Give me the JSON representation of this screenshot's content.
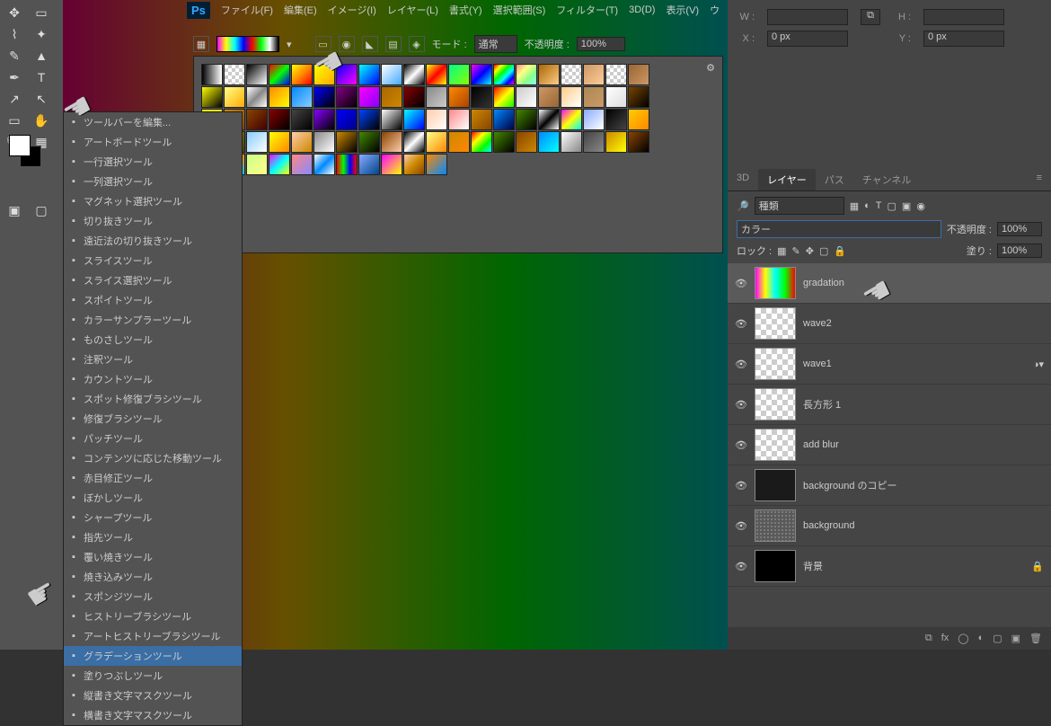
{
  "menu": {
    "items": [
      "ファイル(F)",
      "編集(E)",
      "イメージ(I)",
      "レイヤー(L)",
      "書式(Y)",
      "選択範囲(S)",
      "フィルター(T)",
      "3D(D)",
      "表示(V)",
      "ウ"
    ],
    "ps": "Ps"
  },
  "option_bar": {
    "mode_label": "モード :",
    "mode_value": "通常",
    "opacity_label": "不透明度 :",
    "opacity_value": "100%"
  },
  "props": {
    "w": "W :",
    "h": "H :",
    "x": "X :",
    "y": "Y :",
    "x_val": "0 px",
    "y_val": "0 px"
  },
  "tabs": {
    "items": [
      "3D",
      "レイヤー",
      "パス",
      "チャンネル"
    ],
    "active": 1
  },
  "layer_opts": {
    "kind": "種類",
    "blend": "カラー",
    "opacity_label": "不透明度 :",
    "opacity_value": "100%",
    "lock_label": "ロック :",
    "fill_label": "塗り :",
    "fill_value": "100%"
  },
  "layers": [
    {
      "name": "gradation",
      "thumb": "grad",
      "sel": true
    },
    {
      "name": "wave2",
      "thumb": "checker"
    },
    {
      "name": "wave1",
      "thumb": "checker",
      "fx": true
    },
    {
      "name": "長方形 1",
      "thumb": "checker"
    },
    {
      "name": "add blur",
      "thumb": "checker"
    },
    {
      "name": "background のコピー",
      "thumb": "dark"
    },
    {
      "name": "background",
      "thumb": "noise"
    },
    {
      "name": "背景",
      "thumb": "black",
      "lock": true
    }
  ],
  "tool_menu": {
    "items": [
      "ツールバーを編集...",
      "アートボードツール",
      "一行選択ツール",
      "一列選択ツール",
      "マグネット選択ツール",
      "切り抜きツール",
      "遠近法の切り抜きツール",
      "スライスツール",
      "スライス選択ツール",
      "スポイトツール",
      "カラーサンプラーツール",
      "ものさしツール",
      "注釈ツール",
      "カウントツール",
      "スポット修復ブラシツール",
      "修復ブラシツール",
      "パッチツール",
      "コンテンツに応じた移動ツール",
      "赤目修正ツール",
      "ぼかしツール",
      "シャープツール",
      "指先ツール",
      "覆い焼きツール",
      "焼き込みツール",
      "スポンジツール",
      "ヒストリーブラシツール",
      "アートヒストリーブラシツール",
      "グラデーションツール",
      "塗りつぶしツール",
      "縦書き文字マスクツール",
      "横書き文字マスクツール"
    ],
    "selected": 27
  },
  "gradient_swatches": [
    "linear-gradient(90deg,#000,#fff)",
    "repeating-conic-gradient(#ccc 0 25%,#fff 0 50%) 0 0/8px 8px",
    "linear-gradient(135deg,#000,#fff)",
    "linear-gradient(135deg,#f00,#0f0,#00f)",
    "linear-gradient(135deg,#ff0,#f80,#f00)",
    "linear-gradient(135deg,#ff0,#fa0)",
    "linear-gradient(135deg,#00f,#80f,#f0f)",
    "linear-gradient(135deg,#0ff,#00f)",
    "linear-gradient(135deg,#fff,#4af)",
    "linear-gradient(135deg,#000,#fff,#000)",
    "linear-gradient(135deg,#ff0,#f00,#ff0)",
    "linear-gradient(135deg,#0f8,#8f0)",
    "linear-gradient(135deg,#f0f,#00f,#0ff)",
    "linear-gradient(135deg,#f00,#ff0,#0f0,#0ff,#00f,#f0f)",
    "linear-gradient(135deg,#f88,#ff8,#8f8,#8ff)",
    "linear-gradient(135deg,#a60,#fc8)",
    "repeating-conic-gradient(#ccc 0 25%,#fff 0 50%) 0 0/8px 8px",
    "linear-gradient(135deg,#c96,#fc9)",
    "repeating-conic-gradient(#ccc 0 25%,#fff 0 50%) 0 0/8px 8px",
    "linear-gradient(135deg,#963,#c96)",
    "linear-gradient(135deg,#ff0,#000)",
    "linear-gradient(135deg,#ff8,#fa0)",
    "linear-gradient(135deg,#fff,#888,#fff)",
    "linear-gradient(135deg,#f80,#ff0)",
    "linear-gradient(135deg,#08f,#8cf)",
    "linear-gradient(135deg,#00f,#000)",
    "linear-gradient(135deg,#808,#000)",
    "linear-gradient(135deg,#f0f,#80f)",
    "linear-gradient(135deg,#a60,#c80)",
    "linear-gradient(135deg,#800,#000)",
    "linear-gradient(135deg,#888,#ccc)",
    "linear-gradient(135deg,#f80,#a40)",
    "linear-gradient(135deg,#000,#333)",
    "linear-gradient(135deg,#f00,#ff0,#0f0)",
    "linear-gradient(135deg,#ccc,#fff)",
    "linear-gradient(135deg,#c96,#963)",
    "linear-gradient(135deg,#fc8,#fff)",
    "linear-gradient(135deg,#a85,#c96)",
    "linear-gradient(135deg,#fff,#ddd)",
    "linear-gradient(135deg,#740,#000)",
    "linear-gradient(135deg,#ff0,#cc0)",
    "linear-gradient(135deg,#c80,#840)",
    "linear-gradient(135deg,#840,#400)",
    "linear-gradient(135deg,#800,#000)",
    "linear-gradient(135deg,#444,#000)",
    "linear-gradient(135deg,#80f,#000)",
    "linear-gradient(135deg,#00f,#008)",
    "linear-gradient(135deg,#04f,#000)",
    "linear-gradient(135deg,#fff,#000)",
    "linear-gradient(135deg,#0ff,#00f)",
    "linear-gradient(135deg,#fca,#fff)",
    "linear-gradient(135deg,#f88,#fff)",
    "linear-gradient(135deg,#c80,#840)",
    "linear-gradient(135deg,#08f,#004)",
    "linear-gradient(135deg,#480,#000)",
    "linear-gradient(135deg,#fff,#000,#fff)",
    "linear-gradient(135deg,#f0f,#ff0,#0ff)",
    "linear-gradient(135deg,#8af,#fff)",
    "linear-gradient(135deg,#000,#444)",
    "linear-gradient(135deg,#fc0,#f80)",
    "linear-gradient(135deg,#ff0,#880)",
    "linear-gradient(135deg,#880,#440)",
    "linear-gradient(135deg,#8cf,#fff)",
    "linear-gradient(135deg,#ff0,#f80)",
    "linear-gradient(135deg,#fca,#c80)",
    "linear-gradient(135deg,#888,#fff)",
    "linear-gradient(135deg,#c80,#000)",
    "linear-gradient(135deg,#480,#000)",
    "linear-gradient(135deg,#840,#fca)",
    "linear-gradient(135deg,#000,#fff,#000)",
    "linear-gradient(135deg,#ff8,#f80)",
    "linear-gradient(135deg,#c80,#f80)",
    "linear-gradient(135deg,#f00,#ff0,#0f0,#0ff)",
    "linear-gradient(135deg,#480,#000)",
    "linear-gradient(135deg,#840,#c80)",
    "linear-gradient(135deg,#08f,#0ff)",
    "linear-gradient(135deg,#fff,#888)",
    "linear-gradient(135deg,#444,#888)",
    "linear-gradient(135deg,#c80,#ff0)",
    "linear-gradient(135deg,#840,#000)",
    "linear-gradient(135deg,#f8c,#8cf,#cf8)",
    "linear-gradient(135deg,#fc0,#f80,#0cf)",
    "linear-gradient(135deg,#cf8,#ff8)",
    "linear-gradient(135deg,#f0f,#0ff,#ff0)",
    "linear-gradient(135deg,#f88,#88f)",
    "linear-gradient(135deg,#fff,#08f,#fff)",
    "linear-gradient(90deg,#f00,#0f0,#00f,#f00)",
    "linear-gradient(135deg,#8af,#048)",
    "linear-gradient(135deg,#f0f,#ff0)",
    "linear-gradient(135deg,#fca,#c80,#840)",
    "linear-gradient(135deg,#f80,#08f)"
  ]
}
